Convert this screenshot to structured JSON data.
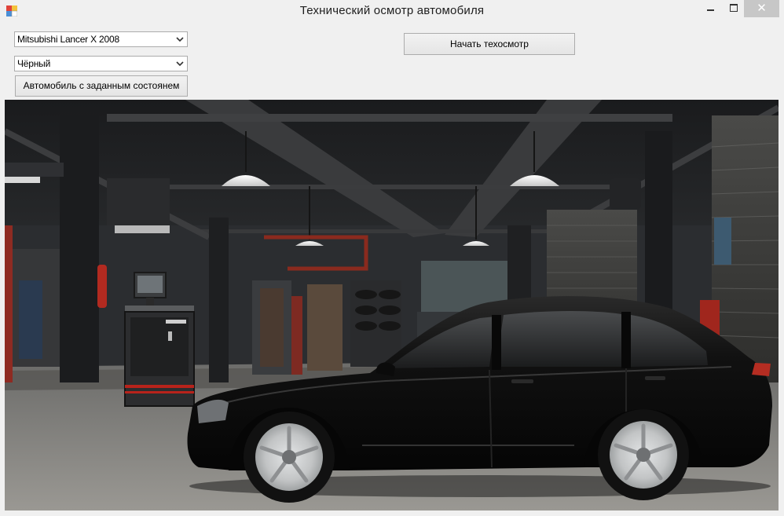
{
  "window": {
    "title": "Технический осмотр автомобиля",
    "close_glyph": "✕",
    "icons": [
      "app-icon",
      "minimize-icon",
      "maximize-icon",
      "close-icon"
    ]
  },
  "controls": {
    "car_model": {
      "selected": "Mitsubishi Lancer X 2008"
    },
    "car_color": {
      "selected": "Чёрный"
    },
    "preset_button_label": "Автомобиль с заданным состоянем",
    "start_button_label": "Начать техосмотр"
  },
  "scene": {
    "description_icons": [
      "garage-background",
      "diagnostic-stand",
      "car-image"
    ],
    "car_color": "#0d0d0d",
    "wheel_color": "#c9cbcc"
  }
}
